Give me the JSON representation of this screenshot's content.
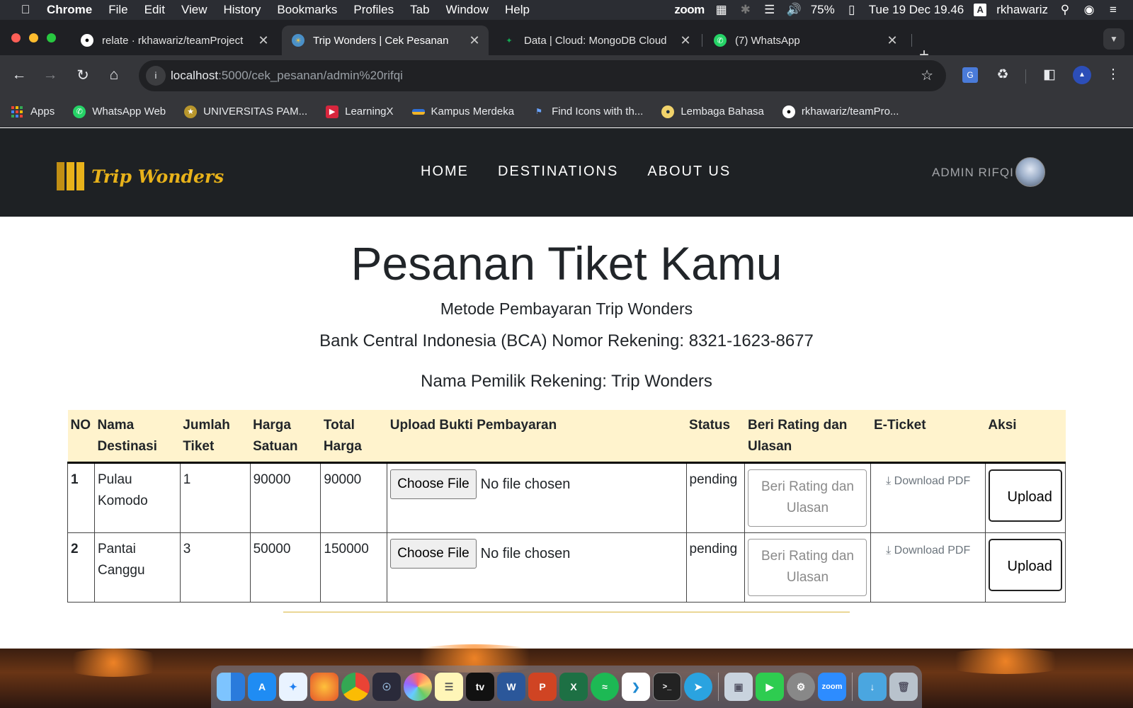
{
  "menubar": {
    "app": "Chrome",
    "items": [
      "File",
      "Edit",
      "View",
      "History",
      "Bookmarks",
      "Profiles",
      "Tab",
      "Window",
      "Help"
    ],
    "zoom": "zoom",
    "battery": "75%",
    "datetime": "Tue 19 Dec  19.46",
    "input_source": "A",
    "user": "rkhawariz"
  },
  "tabs": [
    {
      "title": "relate · rkhawariz/teamProject",
      "icon": "github-icon",
      "active": false
    },
    {
      "title": "Trip Wonders | Cek Pesanan",
      "icon": "tripwonders-icon",
      "active": true
    },
    {
      "title": "Data | Cloud: MongoDB Cloud",
      "icon": "mongodb-icon",
      "active": false
    },
    {
      "title": "(7) WhatsApp",
      "icon": "whatsapp-icon",
      "active": false
    }
  ],
  "omnibox": {
    "host": "localhost",
    "path": ":5000/cek_pesanan/admin%20rifqi"
  },
  "bookmarks": [
    {
      "label": "Apps",
      "icon": "apps-grid-icon"
    },
    {
      "label": "WhatsApp Web",
      "icon": "whatsapp-icon"
    },
    {
      "label": "UNIVERSITAS PAM...",
      "icon": "university-icon"
    },
    {
      "label": "LearningX",
      "icon": "learningx-icon"
    },
    {
      "label": "Kampus Merdeka",
      "icon": "kampus-merdeka-icon"
    },
    {
      "label": "Find Icons with th...",
      "icon": "flag-icon"
    },
    {
      "label": "Lembaga Bahasa",
      "icon": "lembaga-icon"
    },
    {
      "label": "rkhawariz/teamPro...",
      "icon": "github-icon"
    }
  ],
  "site": {
    "logo_text": "Trip Wonders",
    "nav": [
      "HOME",
      "DESTINATIONS",
      "ABOUT US"
    ],
    "admin_name": "ADMIN RIFQI",
    "heading": "Pesanan Tiket Kamu",
    "payment_title": "Metode Pembayaran Trip Wonders",
    "bank_info": "Bank Central Indonesia (BCA) Nomor Rekening: 8321-1623-8677",
    "owner_info": "Nama Pemilik Rekening: Trip Wonders",
    "table": {
      "headers": [
        "NO",
        "Nama Destinasi",
        "Jumlah Tiket",
        "Harga Satuan",
        "Total Harga",
        "Upload Bukti Pembayaran",
        "Status",
        "Beri Rating dan Ulasan",
        "E-Ticket",
        "Aksi"
      ],
      "rows": [
        {
          "no": "1",
          "destinasi": "Pulau Komodo",
          "jumlah": "1",
          "harga": "90000",
          "total": "90000",
          "choose": "Choose File",
          "nofile": "No file chosen",
          "status": "pending",
          "rating": "Beri Rating dan Ulasan",
          "download": "Download PDF",
          "aksi": "Upload"
        },
        {
          "no": "2",
          "destinasi": "Pantai Canggu",
          "jumlah": "3",
          "harga": "50000",
          "total": "150000",
          "choose": "Choose File",
          "nofile": "No file chosen",
          "status": "pending",
          "rating": "Beri Rating dan Ulasan",
          "download": "Download PDF",
          "aksi": "Upload"
        }
      ]
    }
  },
  "colors": {
    "accent": "#e8b21a",
    "nav_bg": "#1e2124",
    "table_head": "#fff3cd"
  }
}
